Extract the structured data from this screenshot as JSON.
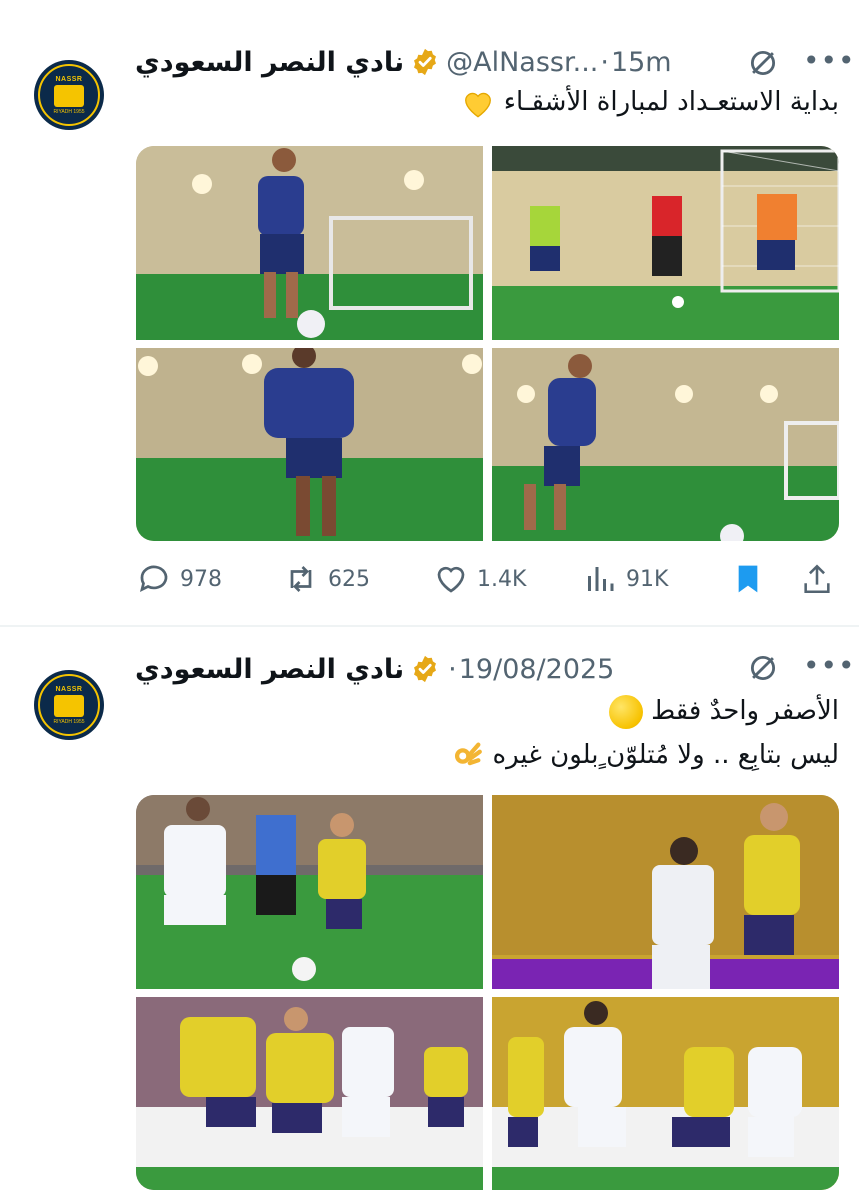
{
  "tweets": [
    {
      "name": "نادي النصر السعودي",
      "handle": "@AlNassr...",
      "dot": "·",
      "time": "15m",
      "text": "بداية الاستعـداد لمباراة الأشقـاء",
      "stats": {
        "replies": "978",
        "reposts": "625",
        "likes": "1.4K",
        "views": "91K"
      }
    },
    {
      "name": "نادي النصر السعودي",
      "dot": "·",
      "time": "19/08/2025",
      "text_line1": "الأصفر واحدٌ فقط",
      "text_line2": "ليس بتابِع .. ولا مُتلوّن ٍبلون غيره"
    }
  ],
  "avatar": {
    "top_text": "NASSR",
    "bottom_text": "RIYADH 1955"
  },
  "colors": {
    "brand_yellow": "#f5c400",
    "brand_navy": "#0b2a4a",
    "bookmark_blue": "#1d9bf0",
    "muted": "#536471"
  },
  "icons": [
    "verified-badge-icon",
    "grok-icon",
    "more-icon",
    "reply-icon",
    "repost-icon",
    "like-icon",
    "views-icon",
    "bookmark-icon",
    "share-icon"
  ]
}
